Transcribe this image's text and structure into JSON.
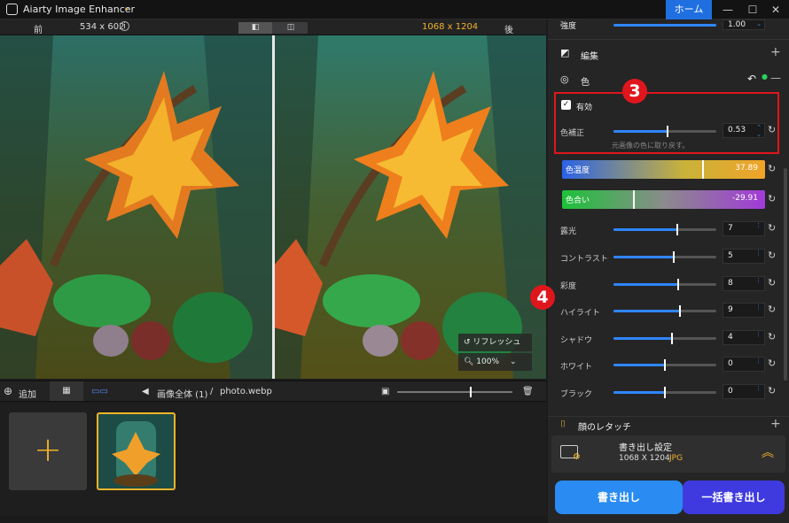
{
  "window": {
    "title": "Aiarty Image Enhancer",
    "home_label": "ホーム"
  },
  "compare": {
    "before_label": "前",
    "before_size": "534 x 602",
    "after_size": "1068 x 1204",
    "after_label": "後"
  },
  "preview": {
    "refresh_label": "リフレッシュ",
    "zoom": "100%"
  },
  "filebar": {
    "add_label": "追加",
    "breadcrumb_all": "画像全体 (1)",
    "separator": "/",
    "filename": "photo.webp"
  },
  "right": {
    "strength_label": "強度",
    "strength_value": "1.00",
    "edit_title": "編集",
    "color_title": "色",
    "enabled_label": "有効",
    "color_correct_label": "色補正",
    "color_correct_value": "0.53",
    "color_correct_level": 0.53,
    "color_correct_hint": "元画像の色に取り戻す。",
    "temperature": {
      "label": "色温度",
      "value": "37.89",
      "level": 0.689
    },
    "tint": {
      "label": "色合い",
      "value": "-29.91",
      "level": 0.35
    },
    "sliders": [
      {
        "label": "露光",
        "value": "7",
        "level": 0.62
      },
      {
        "label": "コントラスト",
        "value": "5",
        "level": 0.59
      },
      {
        "label": "彩度",
        "value": "8",
        "level": 0.63
      },
      {
        "label": "ハイライト",
        "value": "9",
        "level": 0.65
      },
      {
        "label": "シャドウ",
        "value": "4",
        "level": 0.57
      },
      {
        "label": "ホワイト",
        "value": "0",
        "level": 0.5
      },
      {
        "label": "ブラック",
        "value": "0",
        "level": 0.5
      }
    ],
    "face_retouch_title": "顔のレタッチ",
    "badge3": "3",
    "badge4": "4"
  },
  "export": {
    "title": "書き出し設定",
    "size": "1068 X 1204",
    "format": "JPG",
    "export_label": "書き出し",
    "batch_label": "一括書き出し"
  },
  "colors": {
    "accent": "#2f86ff",
    "gold": "#f0b429",
    "red": "#e0161d"
  }
}
